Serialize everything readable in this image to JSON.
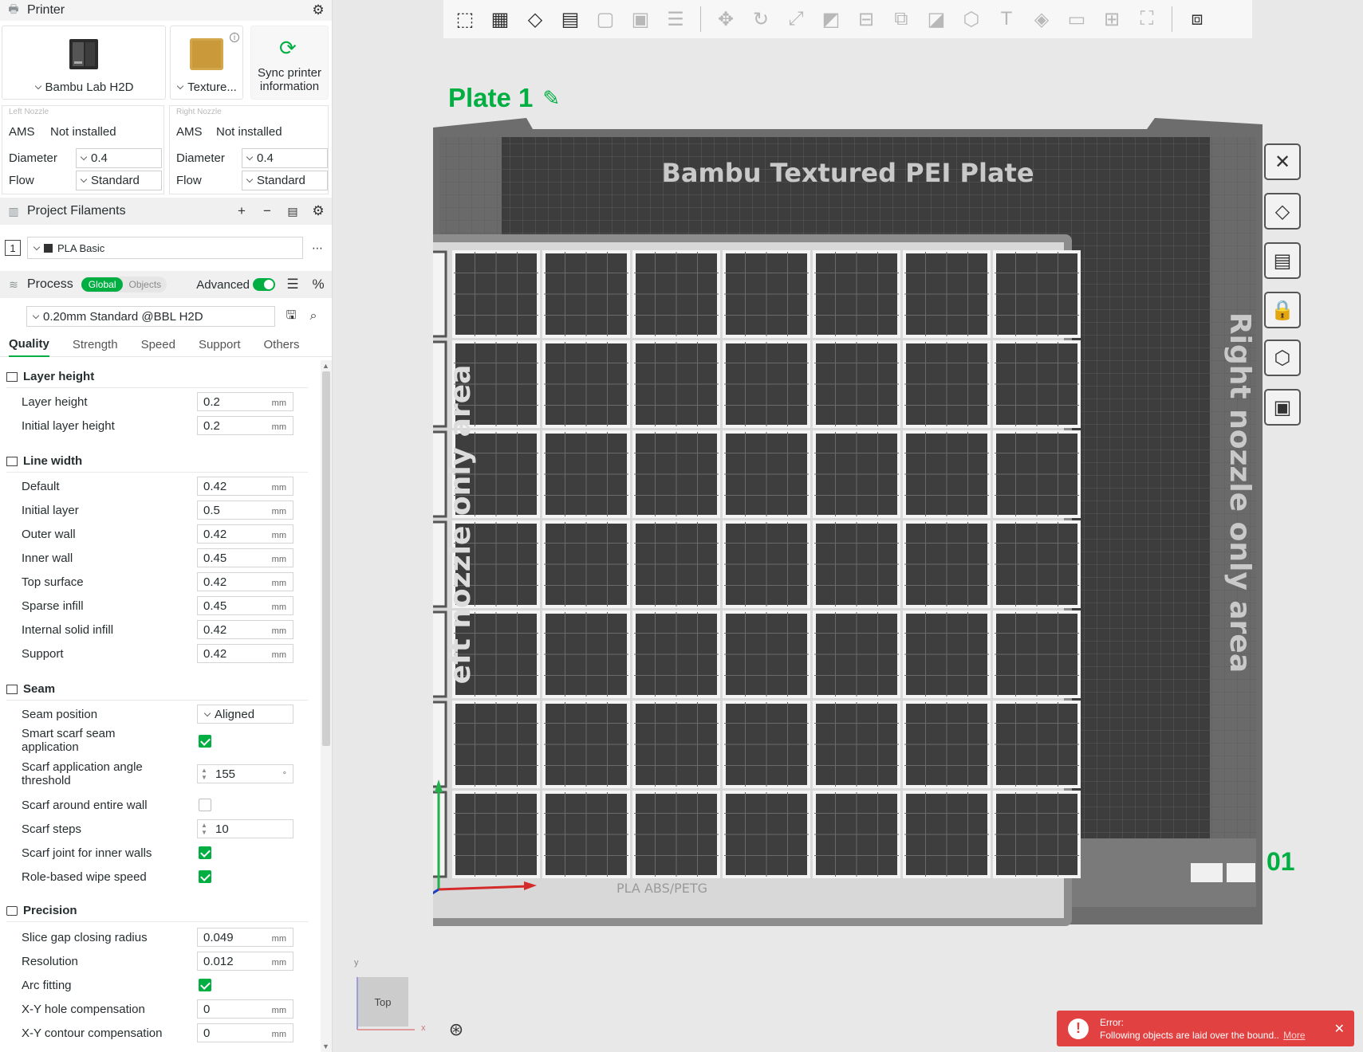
{
  "printer": {
    "section_title": "Printer",
    "printer_name": "Bambu Lab H2D",
    "plate_name": "Texture...",
    "sync_label_1": "Sync printer",
    "sync_label_2": "information",
    "left_nozzle": {
      "title": "Left Nozzle",
      "ams_label": "AMS",
      "ams_value": "Not installed",
      "diameter_label": "Diameter",
      "diameter_value": "0.4",
      "flow_label": "Flow",
      "flow_value": "Standard"
    },
    "right_nozzle": {
      "title": "Right Nozzle",
      "ams_label": "AMS",
      "ams_value": "Not installed",
      "diameter_label": "Diameter",
      "diameter_value": "0.4",
      "flow_label": "Flow",
      "flow_value": "Standard"
    }
  },
  "filaments": {
    "section_title": "Project Filaments",
    "items": [
      {
        "index": "1",
        "name": "PLA Basic"
      }
    ]
  },
  "process": {
    "section_title": "Process",
    "toggle_global": "Global",
    "toggle_objects": "Objects",
    "advanced_label": "Advanced",
    "preset": "0.20mm Standard @BBL H2D",
    "tabs": [
      "Quality",
      "Strength",
      "Speed",
      "Support",
      "Others"
    ],
    "active_tab": "Quality"
  },
  "groups": {
    "layer_height": {
      "title": "Layer height",
      "rows": [
        {
          "label": "Layer height",
          "value": "0.2",
          "unit": "mm"
        },
        {
          "label": "Initial layer height",
          "value": "0.2",
          "unit": "mm"
        }
      ]
    },
    "line_width": {
      "title": "Line width",
      "rows": [
        {
          "label": "Default",
          "value": "0.42",
          "unit": "mm"
        },
        {
          "label": "Initial layer",
          "value": "0.5",
          "unit": "mm"
        },
        {
          "label": "Outer wall",
          "value": "0.42",
          "unit": "mm"
        },
        {
          "label": "Inner wall",
          "value": "0.45",
          "unit": "mm"
        },
        {
          "label": "Top surface",
          "value": "0.42",
          "unit": "mm"
        },
        {
          "label": "Sparse infill",
          "value": "0.45",
          "unit": "mm"
        },
        {
          "label": "Internal solid infill",
          "value": "0.42",
          "unit": "mm"
        },
        {
          "label": "Support",
          "value": "0.42",
          "unit": "mm"
        }
      ]
    },
    "seam": {
      "title": "Seam",
      "seam_position_label": "Seam position",
      "seam_position_value": "Aligned",
      "smart_scarf_label_1": "Smart scarf seam",
      "smart_scarf_label_2": "application",
      "scarf_angle_label_1": "Scarf application angle",
      "scarf_angle_label_2": "threshold",
      "scarf_angle_value": "155",
      "scarf_angle_unit": "°",
      "scarf_entire_label": "Scarf around entire wall",
      "scarf_steps_label": "Scarf steps",
      "scarf_steps_value": "10",
      "scarf_inner_label": "Scarf joint for inner walls",
      "role_wipe_label": "Role-based wipe speed"
    },
    "precision": {
      "title": "Precision",
      "rows": [
        {
          "label": "Slice gap closing radius",
          "value": "0.049",
          "unit": "mm"
        },
        {
          "label": "Resolution",
          "value": "0.012",
          "unit": "mm"
        },
        {
          "label": "X-Y hole compensation",
          "value": "0",
          "unit": "mm"
        },
        {
          "label": "X-Y contour compensation",
          "value": "0",
          "unit": "mm"
        }
      ],
      "arc_fitting_label": "Arc fitting"
    }
  },
  "viewport": {
    "plate_title": "Plate 1",
    "bed_label": "Bambu Textured PEI Plate",
    "left_area_label": "eft nozzle only area",
    "right_area_label": "Right nozzle only area",
    "bed_footer_label": "PLA ABS/PETG",
    "plate_number": "01",
    "view_label": "Top",
    "axis_x": "x",
    "axis_y": "y"
  },
  "error": {
    "title": "Error:",
    "message": "Following objects are laid over the bound..",
    "more": "More"
  }
}
